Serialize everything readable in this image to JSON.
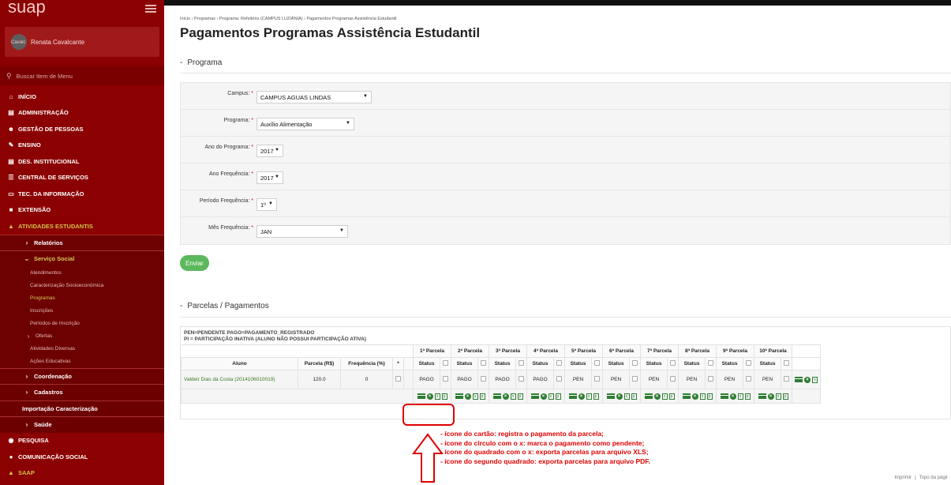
{
  "sidebar": {
    "logo": "suap",
    "user_name": "Renata Cavalcante",
    "user_avatar_text": "Cavalc",
    "search_placeholder": "Buscar Item de Menu",
    "menu": [
      {
        "label": "INÍCIO",
        "icon": "home-icon"
      },
      {
        "label": "ADMINISTRAÇÃO",
        "icon": "briefcase-icon"
      },
      {
        "label": "GESTÃO DE PESSOAS",
        "icon": "users-icon"
      },
      {
        "label": "ENSINO",
        "icon": "pencil-icon"
      },
      {
        "label": "DES. INSTITUCIONAL",
        "icon": "chart-icon"
      },
      {
        "label": "CENTRAL DE SERVIÇOS",
        "icon": "list-icon"
      },
      {
        "label": "TEC. DA INFORMAÇÃO",
        "icon": "monitor-icon"
      },
      {
        "label": "EXTENSÃO",
        "icon": "book-icon"
      },
      {
        "label": "ATIVIDADES ESTUDANTIS",
        "icon": "graduation-cap-icon"
      }
    ],
    "sub_relatorios": "Relatórios",
    "sub_servico_social": "Serviço Social",
    "servico_items": [
      "Atendimentos",
      "Caracterização Socioeconômica",
      "Programas",
      "Inscrições",
      "Períodos de Inscrição"
    ],
    "ofertas": "Ofertas",
    "servico_items2": [
      "Atividades Diversas",
      "Ações Educativas"
    ],
    "coordenacao": "Coordenação",
    "cadastros": "Cadastros",
    "importacao": "Importação Caracterização",
    "saude": "Saúde",
    "pesquisa": "PESQUISA",
    "comunicacao": "COMUNICAÇÃO SOCIAL",
    "saap": "SAAP"
  },
  "main": {
    "breadcrumb": "Início › Programas › Programa: Refeitório (CAMPUS LUZIÂNIA) › Pagamentos Programas Assistência Estudantil",
    "title": "Pagamentos Programas Assistência Estudantil",
    "section_programa": "Programa",
    "section_parcelas": "Parcelas / Pagamentos",
    "form": {
      "campus_label": "Campus:",
      "campus_value": "CAMPUS AGUAS LINDAS",
      "programa_label": "Programa:",
      "programa_value": "Auxílio Alimentação",
      "ano_programa_label": "Ano do Programa:",
      "ano_programa_value": "2017",
      "ano_frequencia_label": "Ano Frequência:",
      "ano_frequencia_value": "2017",
      "periodo_label": "Período Frequência:",
      "periodo_value": "1º",
      "mes_label": "Mês Frequência:",
      "mes_value": "JAN",
      "required_mark": "*"
    },
    "submit_label": "Enviar",
    "legend_line1": "PEN=PENDENTE   PAGO=PAGAMENTO_REGISTRADO",
    "legend_line2": "PI = PARTICIPAÇÃO INATIVA (ALUNO NÃO POSSUI PARTICIPAÇÃO ATIVA)",
    "table": {
      "col_aluno": "Aluno",
      "col_parcela": "Parcela (R$)",
      "col_frequencia": "Frequência (%)",
      "col_star": "*",
      "col_status": "Status",
      "parcelas": [
        "1ª Parcela",
        "2ª Parcela",
        "3ª Parcela",
        "4ª Parcela",
        "5ª Parcela",
        "6ª Parcela",
        "7ª Parcela",
        "8ª Parcela",
        "9ª Parcela",
        "10ª Parcela"
      ],
      "row": {
        "aluno": "Valdeir Dias da Costa (2014106010019)",
        "parcela": "120.0",
        "frequencia": "0",
        "statuses": [
          "PAGO",
          "PAGO",
          "PAGO",
          "PAGO",
          "PEN",
          "PEN",
          "PEN",
          "PEN",
          "PEN",
          "PEN"
        ]
      }
    },
    "notes": [
      "- ícone do cartão: registra o pagamento da parcela;",
      "- ícone do círculo com o x: marca o pagamento como pendente;",
      "- ícone do quadrado com o x: exporta parcelas para arquivo XLS;",
      "- ícone do segundo quadrado: exporta parcelas para arquivo PDF."
    ],
    "footer_print": "Imprimir",
    "footer_top": "Topo da págir"
  },
  "colors": {
    "sidebar": "#8b0000",
    "accent_green": "#5cb85c",
    "icon_green": "#2e7d32",
    "annotation_red": "#e00000"
  }
}
